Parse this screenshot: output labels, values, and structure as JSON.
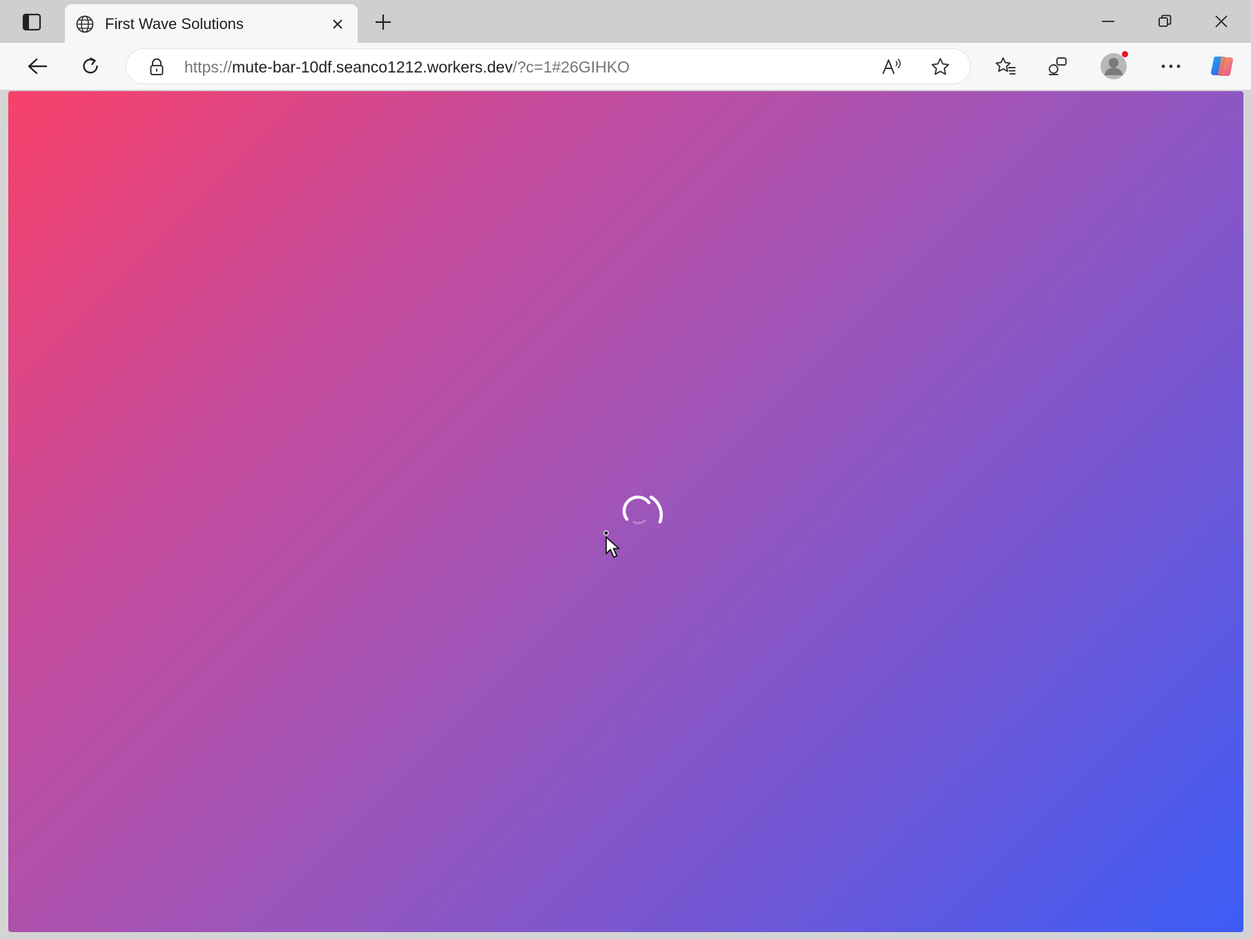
{
  "browser": {
    "tab": {
      "title": "First Wave Solutions",
      "favicon": "globe-icon"
    },
    "address": {
      "url_scheme": "https://",
      "url_host": "mute-bar-10df.seanco1212.workers.dev",
      "url_rest": "/?c=1#26GIHKO"
    },
    "toolbar_icons": [
      "back-arrow-icon",
      "refresh-icon",
      "lock-icon",
      "read-aloud-icon",
      "star-icon",
      "favorites-icon",
      "collections-icon",
      "profile-icon",
      "more-icon",
      "copilot-icon"
    ],
    "read_aloud_glyph": "Aᵃ"
  },
  "page": {
    "state": "loading",
    "gradient_colors": [
      "#f8416a",
      "#c84a9a",
      "#9f55b8",
      "#7a56cf",
      "#3c5cf6"
    ],
    "spinner_icon": "loading-spinner-icon"
  }
}
